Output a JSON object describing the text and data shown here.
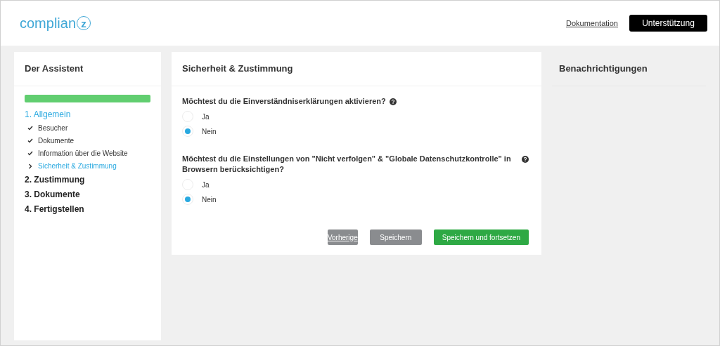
{
  "header": {
    "logo": {
      "text": "complian",
      "mark": "z"
    },
    "links": [
      {
        "kind": "link",
        "label": "Dokumentation"
      },
      {
        "kind": "dark",
        "label": "Unterstützung"
      }
    ]
  },
  "wizard": {
    "title": "Der Assistent",
    "progress": {
      "level": 1
    },
    "steps": [
      {
        "label": "1. Allgemein",
        "selected": true,
        "children": [
          {
            "label": "Besucher",
            "done": true,
            "selected": false
          },
          {
            "label": "Dokumente",
            "done": true,
            "selected": false
          },
          {
            "label": "Information über die Website",
            "done": true,
            "selected": false
          },
          {
            "label": "Sicherheit & Zustimmung",
            "done": false,
            "selected": true
          }
        ]
      },
      {
        "label": "2. Zustimmung",
        "selected": false
      },
      {
        "label": "3. Dokumente",
        "selected": false
      },
      {
        "label": "4. Fertigstellen",
        "selected": false
      }
    ]
  },
  "section": {
    "title": "Sicherheit & Zustimmung",
    "questions": [
      {
        "text": "Möchtest du die Einverständniserklärungen aktivieren?",
        "options": [
          {
            "label": "Ja",
            "selected": false
          },
          {
            "label": "Nein",
            "selected": true
          }
        ]
      },
      {
        "text": "Möchtest du die Einstellungen von \"Nicht verfolgen\" & \"Globale Datenschutzkontrolle\" in Browsern berücksichtigen?",
        "options": [
          {
            "label": "Ja",
            "selected": false
          },
          {
            "label": "Nein",
            "selected": true
          }
        ]
      }
    ],
    "buttons": [
      {
        "kind": "previous",
        "label": "Vorherige"
      },
      {
        "kind": "gray",
        "label": "Speichern"
      },
      {
        "kind": "green",
        "label": "Speichern und fortsetzen"
      }
    ]
  },
  "notifications": {
    "title": "Benachrichtigungen"
  }
}
